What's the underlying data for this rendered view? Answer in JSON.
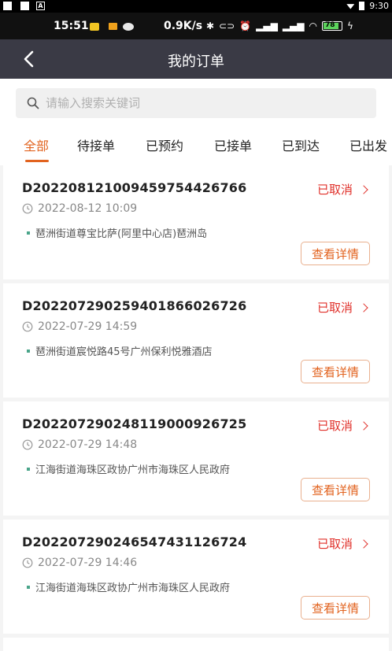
{
  "system_bar": {
    "icon_label": "A",
    "time": "9:30"
  },
  "status_bar": {
    "time": "15:51",
    "speed": "0.9K/s",
    "battery": "78"
  },
  "header": {
    "title": "我的订单"
  },
  "search": {
    "placeholder": "请输入搜索关键词"
  },
  "tabs": [
    {
      "label": "全部",
      "active": true
    },
    {
      "label": "待接单"
    },
    {
      "label": "已预约"
    },
    {
      "label": "已接单"
    },
    {
      "label": "已到达"
    },
    {
      "label": "已出发"
    }
  ],
  "orders": [
    {
      "order_no": "D2022081210094597544267​66",
      "status": "已取消",
      "time": "2022-08-12 10:09",
      "address": "琶洲街道尊宝比萨(阿里中心店)琶洲岛",
      "detail_label": "查看详情"
    },
    {
      "order_no": "D202207290259401866026726",
      "status": "已取消",
      "time": "2022-07-29 14:59",
      "address": "琶洲街道宸悦路45号广州保利悦雅酒店",
      "detail_label": "查看详情"
    },
    {
      "order_no": "D202207290248119000926725",
      "status": "已取消",
      "time": "2022-07-29 14:48",
      "address": "江海街道海珠区政协广州市海珠区人民政府",
      "detail_label": "查看详情"
    },
    {
      "order_no": "D202207290246547431126724",
      "status": "已取消",
      "time": "2022-07-29 14:46",
      "address": "江海街道海珠区政协广州市海珠区人民政府",
      "detail_label": "查看详情"
    }
  ],
  "colors": {
    "accent": "#e2631f",
    "status_cancelled": "#e0302a",
    "header_bg": "#3a3a45"
  }
}
